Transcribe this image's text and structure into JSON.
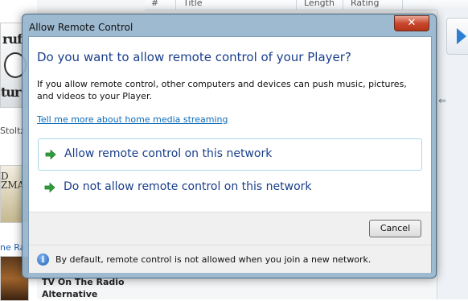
{
  "background": {
    "columns": [
      "#",
      "Title",
      "Length",
      "Rating"
    ],
    "sidebar_texts": [
      "Stoltz",
      "ne Ra"
    ],
    "album_art_texts": [
      "ruf",
      "tur",
      "D\nZMA"
    ],
    "list_rows": [
      "Radio",
      "TV On The Radio",
      "Alternative"
    ],
    "colors": {
      "play_accent": "#2a7fd4"
    }
  },
  "dialog": {
    "title": "Allow Remote Control",
    "close_label": "✕",
    "main_instruction": "Do you want to allow remote control of your Player?",
    "body": "If you allow remote control, other computers and devices can push music, pictures, and videos to your Player.",
    "help_link": "Tell me more about home media streaming",
    "commands": [
      {
        "label": "Allow remote control on this network",
        "icon": "green-arrow-icon",
        "selected": true
      },
      {
        "label": "Do not allow remote control on this network",
        "icon": "green-arrow-icon",
        "selected": false
      }
    ],
    "cancel_label": "Cancel",
    "footer_icon": "info-icon",
    "footer_text": "By default, remote control is not allowed when you join a new network.",
    "colors": {
      "instruction": "#1a3f8b",
      "link": "#0f6cb8",
      "arrow": "#2e9e3a",
      "close": "#c8482e"
    }
  }
}
